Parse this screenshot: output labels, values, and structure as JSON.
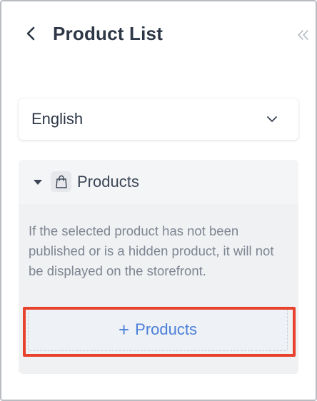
{
  "header": {
    "back_icon": "chevron-left-icon",
    "title": "Product List",
    "collapse_icon": "double-chevron-left-icon"
  },
  "language_select": {
    "value": "English",
    "icon": "chevron-down-icon"
  },
  "products_section": {
    "expand_icon": "caret-down-icon",
    "section_icon": "shopping-bag-icon",
    "title": "Products",
    "note": "If the selected product has not been published or is a hidden product, it will not be displayed on the storefront.",
    "add_button": {
      "plus": "+",
      "label": "Products",
      "color": "#4a7fd9"
    }
  },
  "highlight_color": "#e8412c"
}
